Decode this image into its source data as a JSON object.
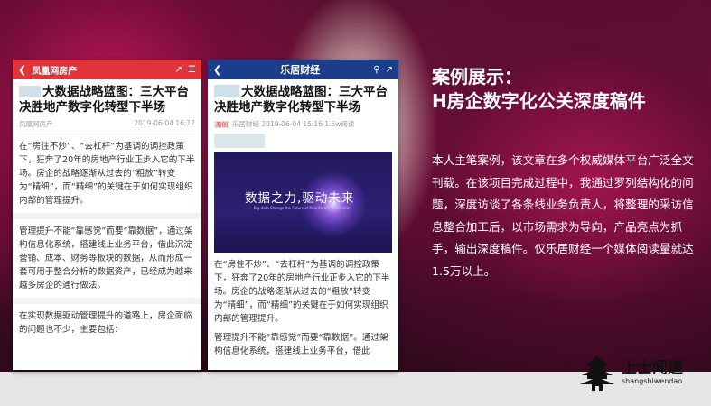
{
  "phone1": {
    "logo": "凤凰网房产",
    "title": "大数据战略蓝图：三大平台决胜地产数字化转型下半场",
    "source": "凤凰网房产",
    "date": "2019-06-04 16:12",
    "paragraphs": [
      "在“房住不炒”、“去杠杆”为基调的调控政策下，狂奔了20年的房地产行业正步入它的下半场。房企的战略逐渐从过去的“粗放”转变为“精细”，而“精细”的关键在于如何实现组织内部的管理提升。",
      "管理提升不能“靠感觉”而要“靠数据”，通过架构信息化系统，搭建线上业务平台，借此沉淀营销、成本、财务等板块的数据，从而形成一套可用于整合分析的数据资产，已经成为越来越多房企的通行做法。",
      "在实现数据驱动管理提升的道路上，房企面临的问题也不少，主要包括："
    ]
  },
  "phone2": {
    "logo": "乐居财经",
    "title": "大数据战略蓝图：三大平台决胜地产数字化转型下半场",
    "tag": "原创",
    "meta": "乐居财经 2019-06-04 15:16 1.5w阅读",
    "cover_text": "数据之力,驱动未来",
    "cover_sub": "Big data Change the Future of Real Estate Generation",
    "paragraphs": [
      "在“房住不炒”、“去杠杆”为基调的调控政策下，狂奔了20年的房地产行业正步入它的下半场。房企的战略逐渐从过去的“粗放”转变为“精细”，而“精细”的关键在于如何实现组织内部的管理提升。",
      "管理提升不能“靠感觉”而要“靠数据”。通过架构信息化系统，搭建线上业务平台，借此"
    ]
  },
  "heading": {
    "line1": "案例展示：",
    "line2": "H房企数字化公关深度稿件"
  },
  "description": "本人主笔案例，该文章在多个权威媒体平台广泛全文刊载。在该项目完成过程中，我通过罗列结构化的问题，深度访谈了各条线业务负责人，将整理的采访信息整合加工后，以市场需求为导向，产品亮点为抓手，输出深度稿件。仅乐居财经一个媒体阅读量就达1.5万以上。",
  "brand": {
    "name": "上士闻道",
    "pinyin": "shangshiwendao"
  }
}
